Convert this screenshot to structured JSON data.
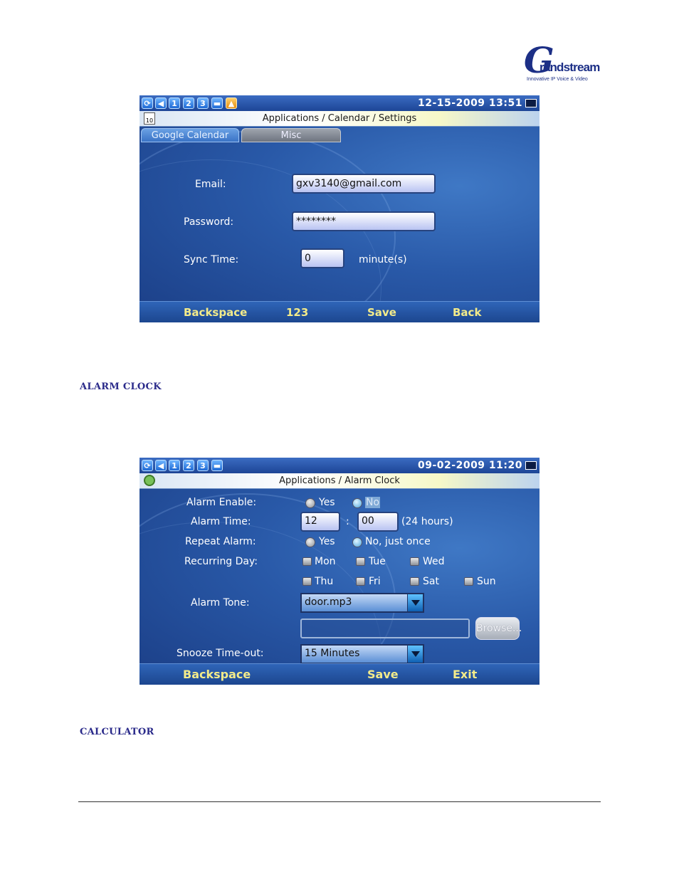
{
  "logo": {
    "letter": "G",
    "word": "randstream",
    "tagline": "Innovative IP Voice & Video"
  },
  "screen1": {
    "status": {
      "icons": [
        "1",
        "2",
        "3"
      ],
      "datetime": "12-15-2009 13:51"
    },
    "title": "Applications / Calendar / Settings",
    "cal_day": "10",
    "tabs": [
      "Google Calendar",
      "Misc"
    ],
    "email": {
      "label": "Email:",
      "value": "gxv3140@gmail.com"
    },
    "password": {
      "label": "Password:",
      "value": "********"
    },
    "sync": {
      "label": "Sync Time:",
      "value": "0",
      "unit": "minute(s)"
    },
    "softkeys": [
      "Backspace",
      "123",
      "Save",
      "Back"
    ]
  },
  "sections": {
    "alarm": "ALARM CLOCK",
    "calculator": "CALCULATOR"
  },
  "screen2": {
    "status": {
      "icons": [
        "1",
        "2",
        "3"
      ],
      "datetime": "09-02-2009 11:20"
    },
    "title": "Applications / Alarm Clock",
    "alarm_enable": {
      "label": "Alarm Enable:",
      "yes": "Yes",
      "no": "No"
    },
    "alarm_time": {
      "label": "Alarm Time:",
      "hour": "12",
      "sep": ":",
      "minute": "00",
      "note": "(24 hours)"
    },
    "repeat": {
      "label": "Repeat Alarm:",
      "yes": "Yes",
      "no": "No, just once"
    },
    "recurring": {
      "label": "Recurring Day:",
      "days": [
        "Mon",
        "Tue",
        "Wed",
        "Thu",
        "Fri",
        "Sat",
        "Sun"
      ]
    },
    "tone": {
      "label": "Alarm Tone:",
      "value": "door.mp3",
      "browse": "Browse..."
    },
    "snooze": {
      "label": "Snooze Time-out:",
      "value": "15 Minutes"
    },
    "softkeys": [
      "Backspace",
      "Save",
      "Exit"
    ]
  }
}
